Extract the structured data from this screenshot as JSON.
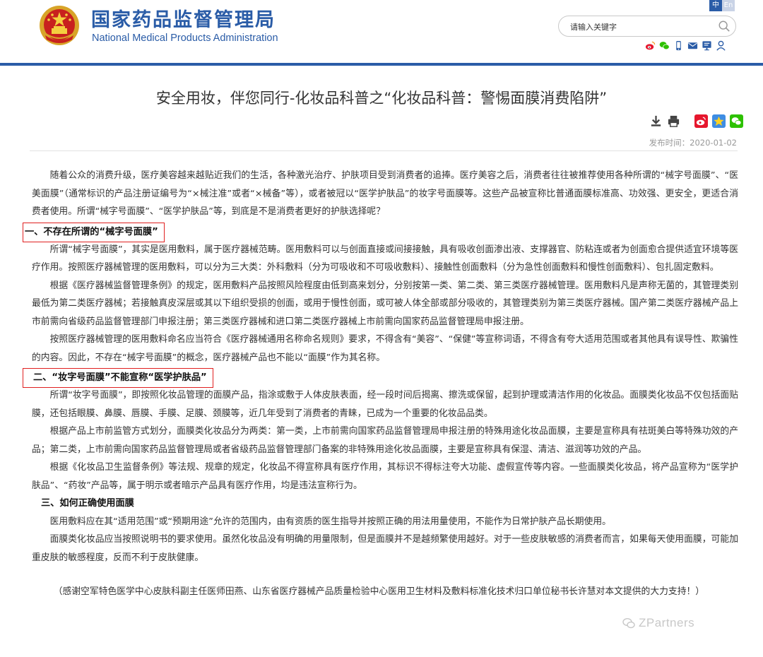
{
  "header": {
    "site_name_cn": "国家药品监督管理局",
    "site_name_en": "National Medical Products Administration",
    "lang_zh": "中",
    "lang_en": "En",
    "search_placeholder": "请输入关键字",
    "icons": [
      "weibo-icon",
      "wechat-icon",
      "mobile-icon",
      "mail-icon",
      "message-board-icon",
      "user-icon"
    ]
  },
  "article": {
    "title": "安全用妆，伴您同行-化妆品科普之“化妆品科普：警惕面膜消费陷阱”",
    "share_icons": [
      "download-icon",
      "print-icon",
      "share-weibo-icon",
      "favorite-icon",
      "share-wechat-icon"
    ],
    "publish_label": "发布时间：",
    "publish_date": "2020-01-02",
    "intro": "随着公众的消费升级，医疗美容越来越贴近我们的生活，各种激光治疗、护肤项目受到消费者的追捧。医疗美容之后，消费者往往被推荐使用各种所谓的“械字号面膜”、“医美面膜”（通常标识的产品注册证编号为“×械注准”或者“×械备”等），或者被冠以“医学护肤品”的妆字号面膜等。这些产品被宣称比普通面膜标准高、功效强、更安全，更适合消费者使用。所谓“械字号面膜”、“医学护肤品”等，到底是不是消费者更好的护肤选择呢？",
    "sections": [
      {
        "heading": "一、不存在所谓的“械字号面膜”",
        "paragraphs": [
          "所谓“械字号面膜”，其实是医用敷料，属于医疗器械范畴。医用敷料可以与创面直接或间接接触，具有吸收创面渗出液、支撑器官、防粘连或者为创面愈合提供适宜环境等医疗作用。按照医疗器械管理的医用敷料，可以分为三大类：外科敷料（分为可吸收和不可吸收敷料）、接触性创面敷料（分为急性创面敷料和慢性创面敷料）、包扎固定敷料。",
          "根据《医疗器械监督管理条例》的规定，医用敷料产品按照风险程度由低到高来划分，分别按第一类、第二类、第三类医疗器械管理。医用敷料凡是声称无菌的，其管理类别最低为第二类医疗器械；若接触真皮深层或其以下组织受损的创面，或用于慢性创面，或可被人体全部或部分吸收的，其管理类别为第三类医疗器械。国产第二类医疗器械产品上市前需向省级药品监督管理部门申报注册；第三类医疗器械和进口第二类医疗器械上市前需向国家药品监督管理局申报注册。",
          "按照医疗器械管理的医用敷料命名应当符合《医疗器械通用名称命名规则》要求，不得含有“美容”、“保健”等宣称词语，不得含有夸大适用范围或者其他具有误导性、欺骗性的内容。因此，不存在“械字号面膜”的概念，医疗器械产品也不能以“面膜”作为其名称。"
        ]
      },
      {
        "heading": "二、“妆字号面膜”不能宣称“医学护肤品”",
        "paragraphs": [
          "所谓“妆字号面膜”，即按照化妆品管理的面膜产品，指涂或敷于人体皮肤表面，经一段时间后揭离、擦洗或保留，起到护理或清洁作用的化妆品。面膜类化妆品不仅包括面贴膜，还包括眼膜、鼻膜、唇膜、手膜、足膜、颈膜等，近几年受到了消费者的青睐，已成为一个重要的化妆品品类。",
          "根据产品上市前监管方式划分，面膜类化妆品分为两类：第一类，上市前需向国家药品监督管理局申报注册的特殊用途化妆品面膜，主要是宣称具有祛斑美白等特殊功效的产品；第二类，上市前需向国家药品监督管理局或者省级药品监督管理部门备案的非特殊用途化妆品面膜，主要是宣称具有保湿、清洁、滋润等功效的产品。",
          "根据《化妆品卫生监督条例》等法规、规章的规定，化妆品不得宣称具有医疗作用，其标识不得标注夸大功能、虚假宣传等内容。一些面膜类化妆品，将产品宣称为“医学护肤品”、“药妆”产品等，属于明示或者暗示产品具有医疗作用，均是违法宣称行为。"
        ]
      },
      {
        "heading": "三、如何正确使用面膜",
        "paragraphs": [
          "医用敷料应在其“适用范围”或“预期用途”允许的范围内，由有资质的医生指导并按照正确的用法用量使用，不能作为日常护肤产品长期使用。",
          "面膜类化妆品应当按照说明书的要求使用。虽然化妆品没有明确的用量限制，但是面膜并不是越频繁使用越好。对于一些皮肤敏感的消费者而言，如果每天使用面膜，可能加重皮肤的敏感程度，反而不利于皮肤健康。"
        ]
      }
    ],
    "credit": "（感谢空军特色医学中心皮肤科副主任医师田燕、山东省医疗器械产品质量检验中心医用卫生材料及敷料标准化技术归口单位秘书长许慧对本文提供的大力支持！）"
  },
  "watermark": "ZPartners",
  "colors": {
    "brand_blue": "#2a5ca7",
    "highlight_red": "#e02020",
    "date_grey": "#999999"
  }
}
